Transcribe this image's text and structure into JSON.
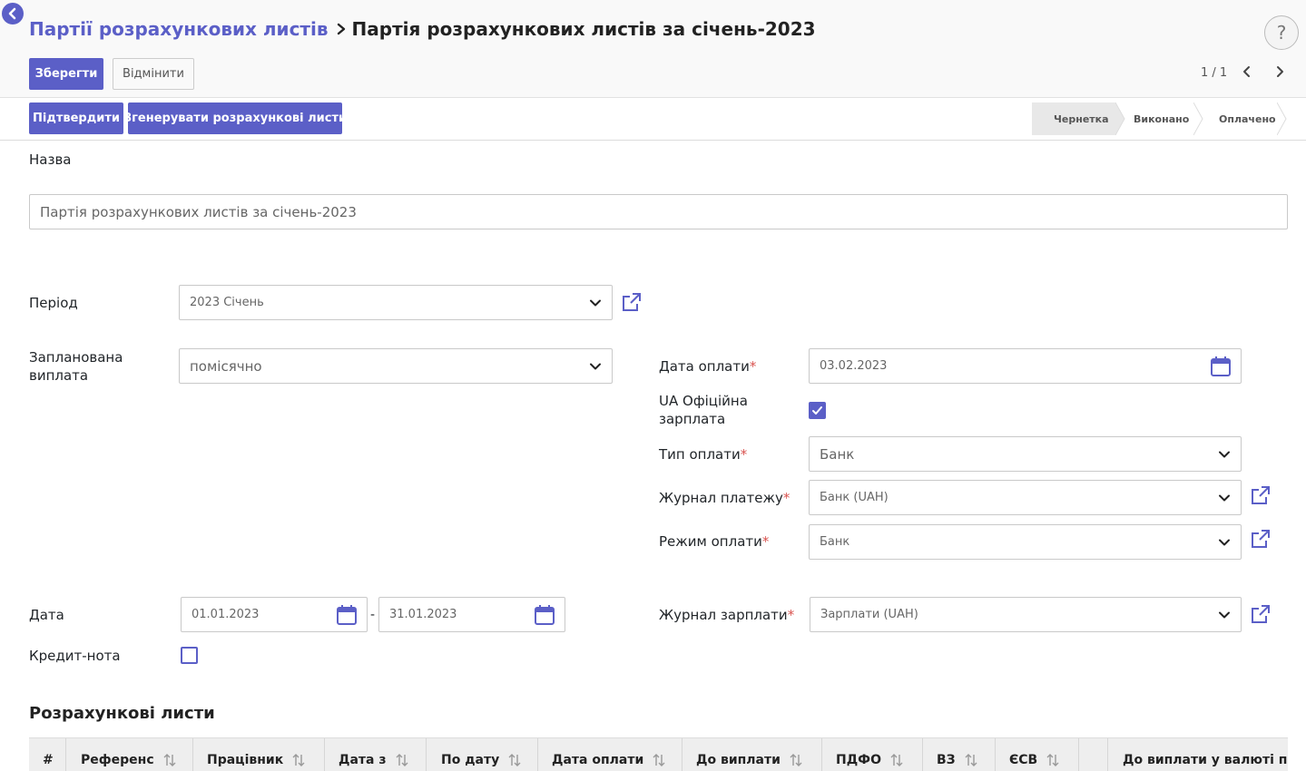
{
  "breadcrumb": {
    "parent": "Партії розрахункових листів",
    "current": "Партія розрахункових листів за січень-2023"
  },
  "toolbar": {
    "save_label": "Зберегти",
    "discard_label": "Відмінити",
    "pager": "1 / 1",
    "help": "?"
  },
  "actions": {
    "confirm_label": "Підтвердити",
    "generate_label": "Згенерувати розрахункові листи"
  },
  "statusbar": {
    "stages": [
      "Чернетка",
      "Виконано",
      "Оплачено"
    ],
    "active": "Чернетка"
  },
  "form": {
    "name_label": "Назва",
    "name_value": "Партія розрахункових листів за січень-2023",
    "period_label": "Період",
    "period_value": "2023 Січень",
    "schedule_label_1": "Запланована",
    "schedule_label_2": "виплата",
    "schedule_value": "помісячно",
    "pay_date_label": "Дата оплати",
    "pay_date_value": "03.02.2023",
    "official_label_1": "UA Офіційна",
    "official_label_2": "зарплата",
    "official_checked": true,
    "pay_type_label": "Тип оплати",
    "pay_type_value": "Банк",
    "pay_journal_label": "Журнал платежу",
    "pay_journal_value": "Банк (UAH)",
    "pay_mode_label": "Режим оплати",
    "pay_mode_value": "Банк",
    "date_label": "Дата",
    "date_from": "01.01.2023",
    "date_sep": "-",
    "date_to": "31.01.2023",
    "salary_journal_label": "Журнал зарплати",
    "salary_journal_value": "Зарплати (UAH)",
    "credit_note_label": "Кредит-нота",
    "credit_note_checked": false,
    "required_mark": "*"
  },
  "table": {
    "title": "Розрахункові листи",
    "columns": [
      "#",
      "Референс",
      "Працівник",
      "Дата з",
      "По дату",
      "Дата оплати",
      "До виплати",
      "ПДФО",
      "ВЗ",
      "ЄСВ",
      "",
      "До виплати у валюті пл"
    ]
  },
  "colors": {
    "accent": "#5b5fc7",
    "required": "#d9534f"
  }
}
